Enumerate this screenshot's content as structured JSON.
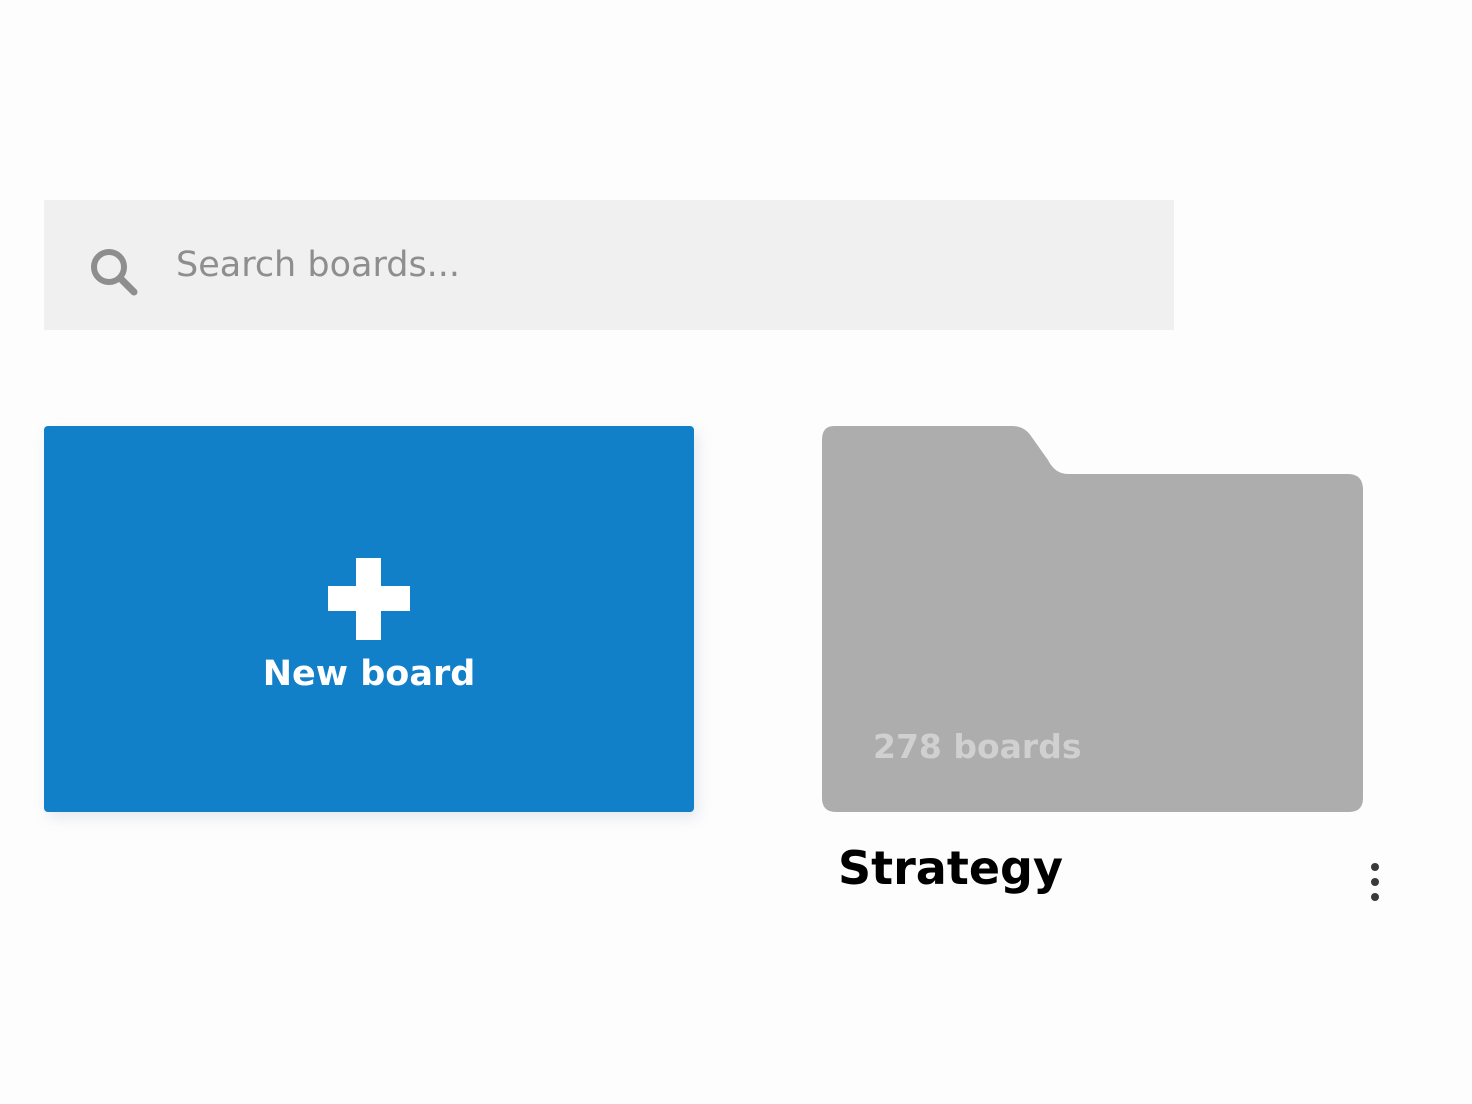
{
  "search": {
    "placeholder": "Search boards...",
    "value": "",
    "icon": "search-icon"
  },
  "new_board": {
    "label": "New board",
    "icon": "plus-icon",
    "color": "#1180c9"
  },
  "folders": [
    {
      "name": "Strategy",
      "count_label": "278 boards",
      "icon": "folder-icon",
      "color": "#adadad",
      "menu_icon": "more-vertical-icon"
    }
  ]
}
